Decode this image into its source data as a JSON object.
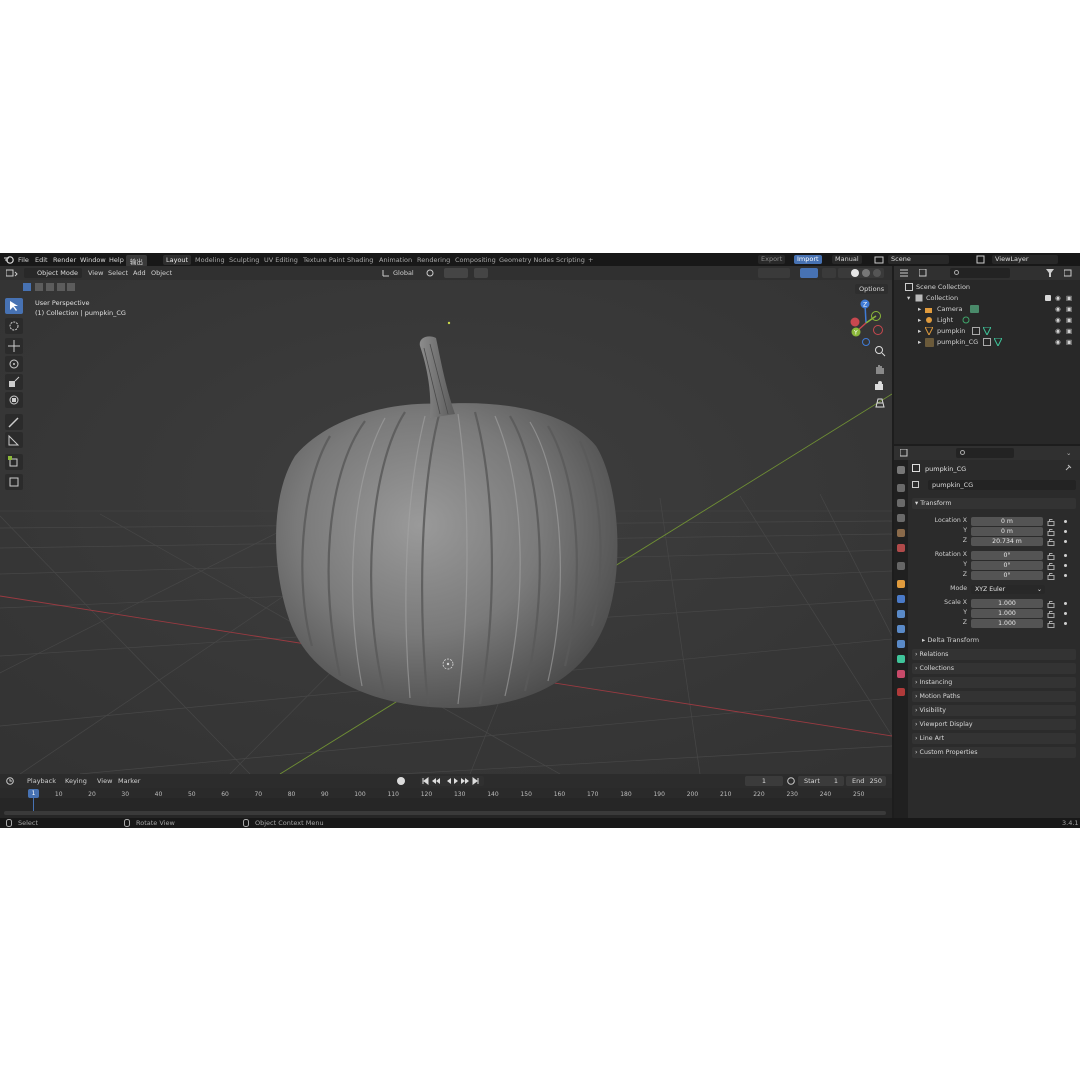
{
  "topbar": {
    "menus": [
      "File",
      "Edit",
      "Render",
      "Window",
      "Help",
      "输出"
    ],
    "workspaces": [
      "Layout",
      "Modeling",
      "Sculpting",
      "UV Editing",
      "Texture Paint",
      "Shading",
      "Animation",
      "Rendering",
      "Compositing",
      "Geometry Nodes",
      "Scripting"
    ],
    "active_workspace": "Layout",
    "plus": "+",
    "export_label": "Export",
    "import_label": "Import",
    "manual_label": "Manual",
    "scene_label": "Scene",
    "viewlayer_label": "ViewLayer"
  },
  "viewport": {
    "mode": "Object Mode",
    "menus": [
      "View",
      "Select",
      "Add",
      "Object"
    ],
    "orientation": "Global",
    "options_label": "Options",
    "overlay_line1": "User Perspective",
    "overlay_line2": "(1) Collection | pumpkin_CG",
    "gizmo_axes": [
      "Z",
      "Y",
      "X"
    ]
  },
  "timeline": {
    "menus": [
      "Playback",
      "Keying",
      "View",
      "Marker"
    ],
    "current_frame": "1",
    "start_label": "Start",
    "start_value": "1",
    "end_label": "End",
    "end_value": "250",
    "ticks": [
      "1",
      "10",
      "20",
      "30",
      "40",
      "50",
      "60",
      "70",
      "80",
      "90",
      "100",
      "110",
      "120",
      "130",
      "140",
      "150",
      "160",
      "170",
      "180",
      "190",
      "200",
      "210",
      "220",
      "230",
      "240",
      "250"
    ]
  },
  "status": {
    "select": "Select",
    "rotate": "Rotate View",
    "context": "Object Context Menu",
    "version": "3.4.1"
  },
  "outliner": {
    "scene_collection": "Scene Collection",
    "collection": "Collection",
    "items": [
      "Camera",
      "Light",
      "pumpkin",
      "pumpkin_CG"
    ]
  },
  "properties": {
    "object_name": "pumpkin_CG",
    "object_field": "pumpkin_CG",
    "transform_title": "Transform",
    "location_label": "Location X",
    "y_label": "Y",
    "z_label": "Z",
    "location": [
      "0 m",
      "0 m",
      "20.734 m"
    ],
    "rotation_label": "Rotation X",
    "rotation": [
      "0°",
      "0°",
      "0°"
    ],
    "mode_label": "Mode",
    "mode_value": "XYZ Euler",
    "scale_label": "Scale X",
    "scale": [
      "1.000",
      "1.000",
      "1.000"
    ],
    "delta": "Delta Transform",
    "panels": [
      "Relations",
      "Collections",
      "Instancing",
      "Motion Paths",
      "Visibility",
      "Viewport Display",
      "Line Art",
      "Custom Properties"
    ]
  },
  "colors": {
    "accent": "#4772b3",
    "viewport_bg": "#3b3b3b",
    "x_axis": "#c8484f",
    "y_axis": "#8bb83a",
    "z_axis": "#3f7bd6"
  }
}
